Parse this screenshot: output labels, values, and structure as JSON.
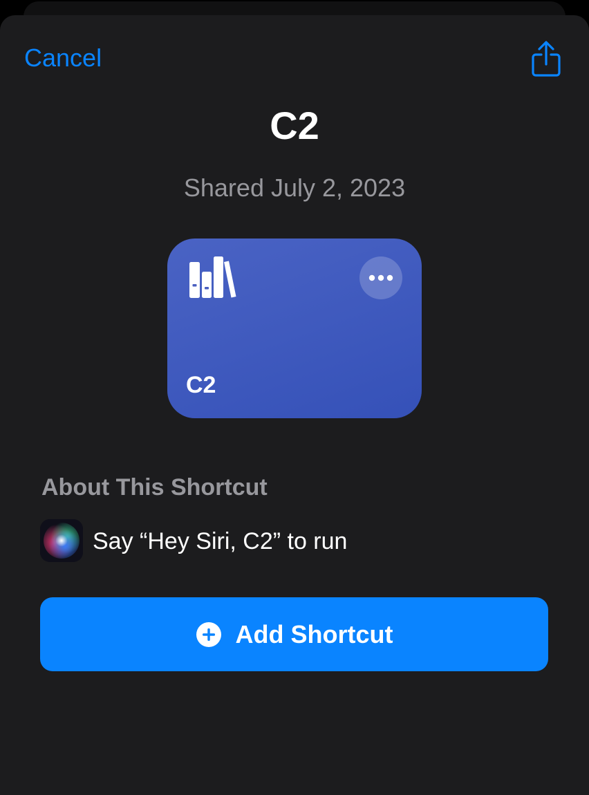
{
  "header": {
    "cancel_label": "Cancel",
    "share_icon": "share-icon"
  },
  "shortcut": {
    "title": "C2",
    "shared_date": "Shared July 2, 2023",
    "card": {
      "name": "C2",
      "glyph_icon": "books-icon",
      "more_icon": "ellipsis-icon",
      "gradient_start": "#4a63c4",
      "gradient_end": "#3551b8"
    }
  },
  "about": {
    "heading": "About This Shortcut",
    "siri_icon": "siri-icon",
    "siri_phrase": "Say “Hey Siri, C2” to run"
  },
  "actions": {
    "add_label": "Add Shortcut",
    "add_icon": "plus-circle-icon"
  },
  "colors": {
    "accent": "#0a84ff",
    "sheet_background": "#1c1c1e",
    "secondary_text": "#98989d"
  }
}
